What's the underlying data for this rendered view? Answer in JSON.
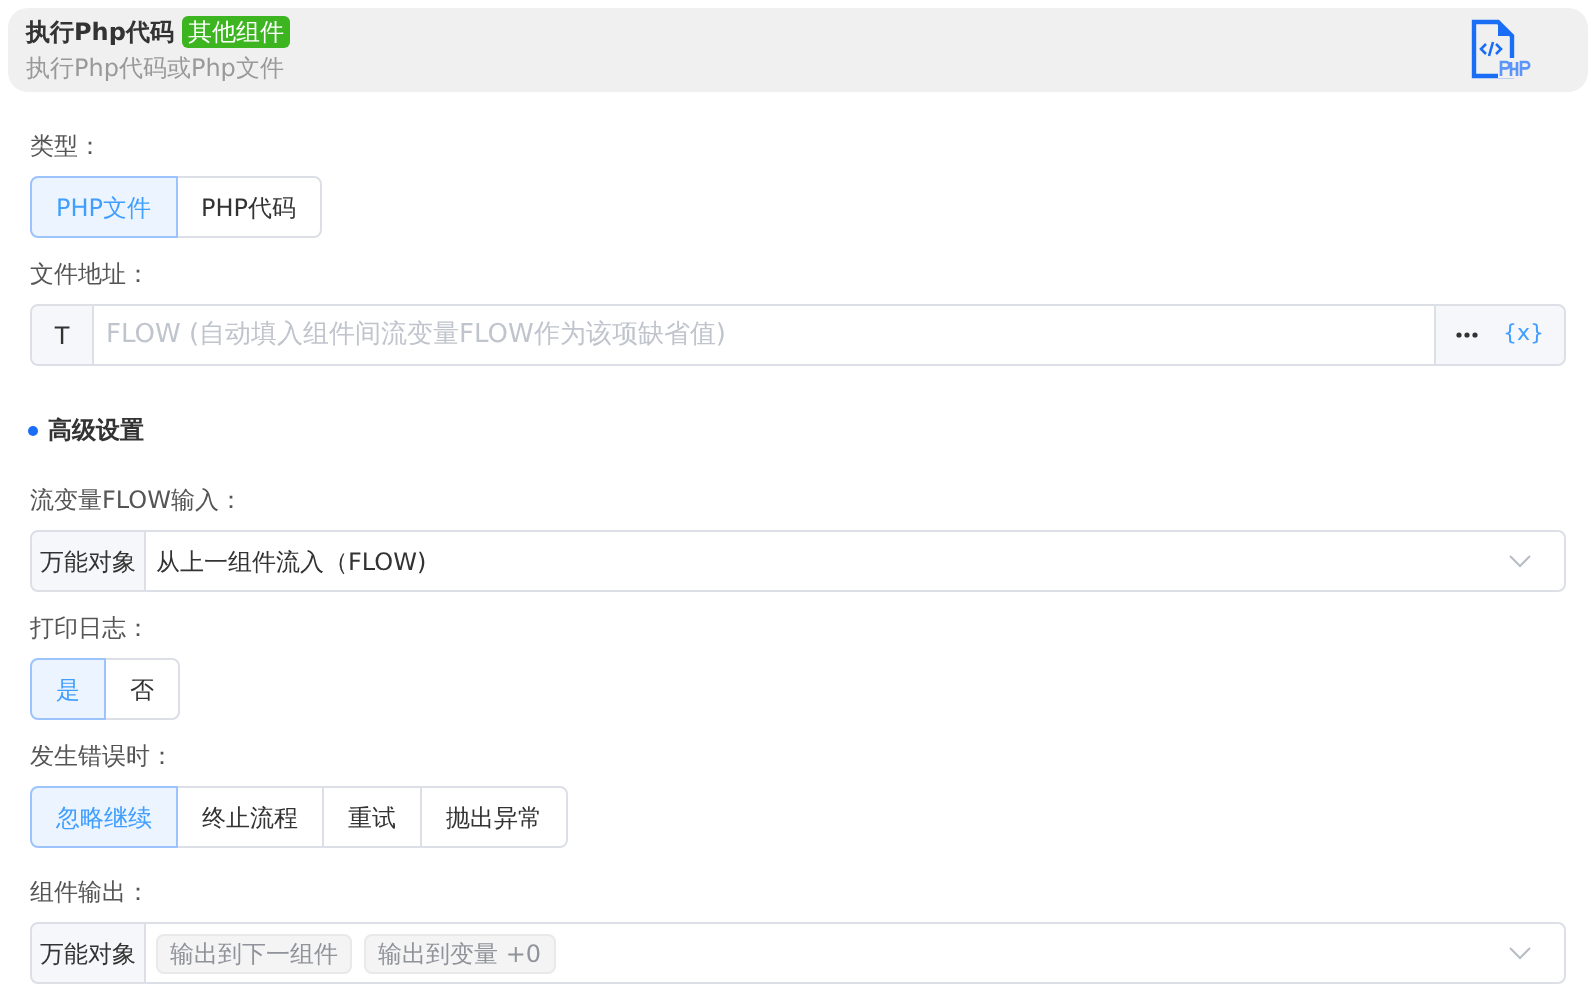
{
  "header": {
    "title": "执行Php代码",
    "badge": "其他组件",
    "subtitle": "执行Php代码或Php文件"
  },
  "items": [
    {
      "kind": "segmented",
      "label": "类型：",
      "options": [
        {
          "label": "PHP文件",
          "selected": true
        },
        {
          "label": "PHP代码",
          "selected": false
        }
      ]
    },
    {
      "kind": "text_input",
      "label": "文件地址：",
      "prefix": "T",
      "placeholder": "FLOW (自动填入组件间流变量FLOW作为该项缺省值)",
      "variable_button": "{x}"
    },
    {
      "kind": "section",
      "title": "高级设置"
    },
    {
      "kind": "select",
      "label": "流变量FLOW输入：",
      "prefix": "万能对象",
      "value": "从上一组件流入（FLOW)"
    },
    {
      "kind": "segmented",
      "label": "打印日志：",
      "options": [
        {
          "label": "是",
          "selected": true
        },
        {
          "label": "否",
          "selected": false
        }
      ]
    },
    {
      "kind": "segmented",
      "label": "发生错误时：",
      "options": [
        {
          "label": "忽略继续",
          "selected": true
        },
        {
          "label": "终止流程",
          "selected": false
        },
        {
          "label": "重试",
          "selected": false
        },
        {
          "label": "抛出异常",
          "selected": false
        }
      ]
    },
    {
      "kind": "tag_select",
      "label": "组件输出：",
      "prefix": "万能对象",
      "tags": [
        "输出到下一组件",
        "输出到变量 +0"
      ]
    }
  ]
}
